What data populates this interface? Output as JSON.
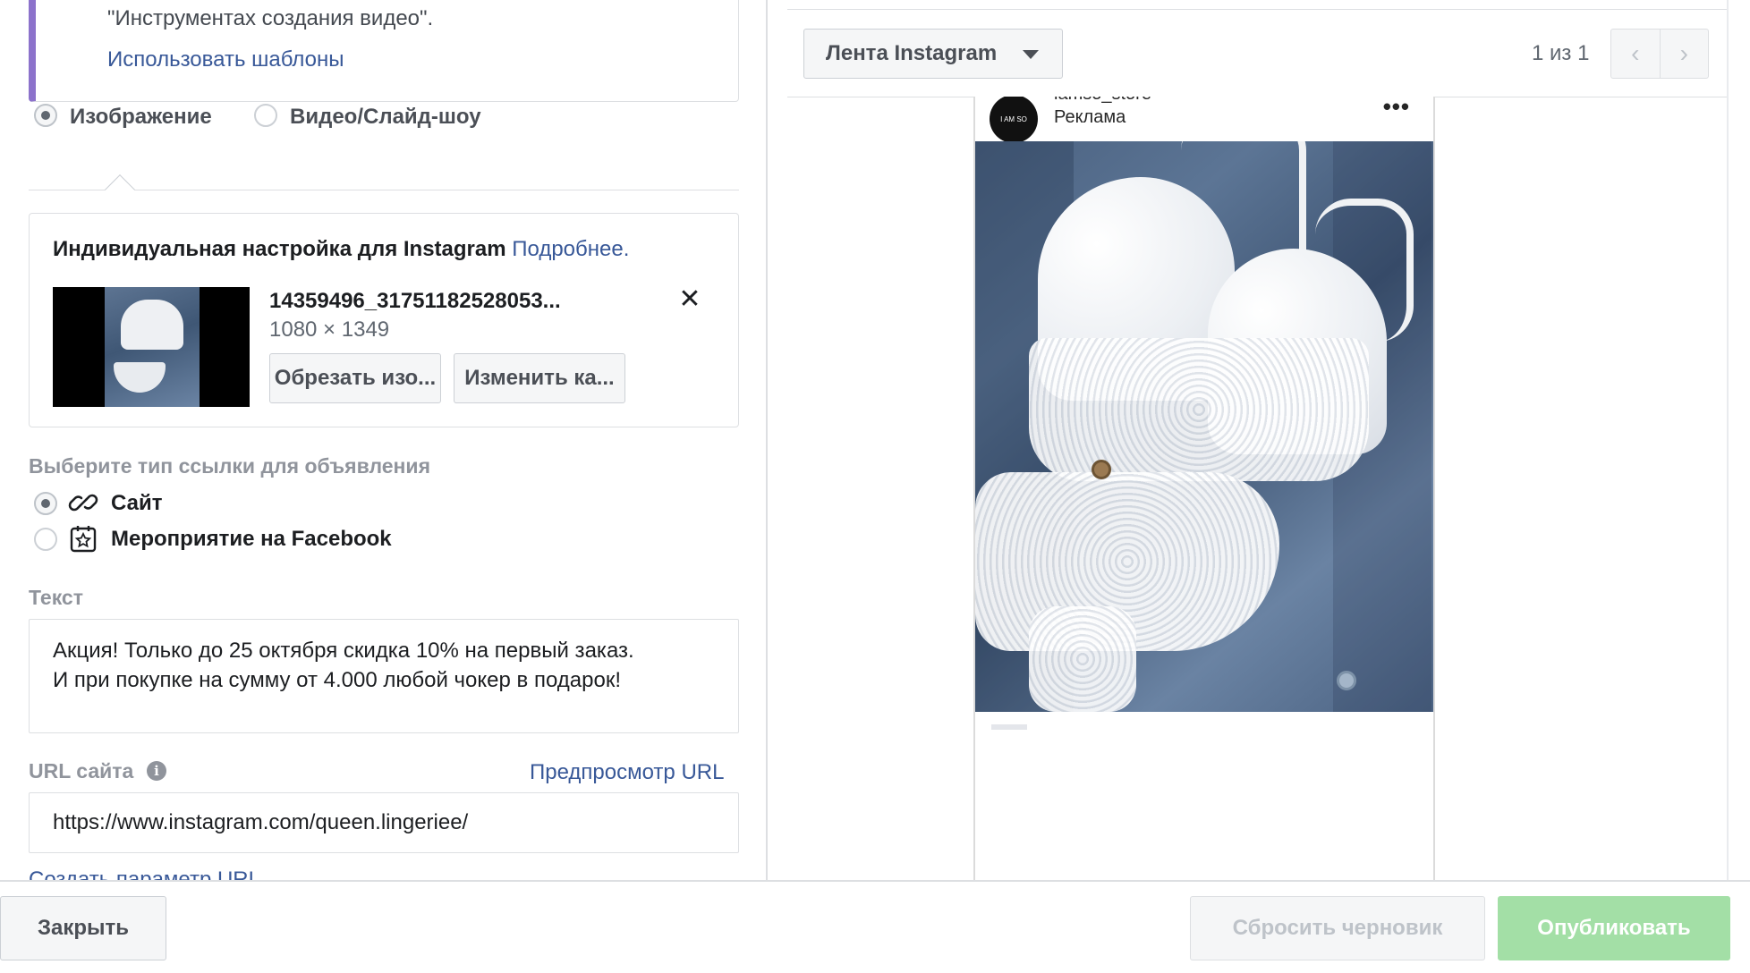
{
  "template_block": {
    "description": "\"Инструментах создания видео\".",
    "link": "Использовать шаблоны"
  },
  "media_type": {
    "options": [
      {
        "label": "Изображение",
        "selected": true
      },
      {
        "label": "Видео/Слайд-шоу",
        "selected": false
      }
    ]
  },
  "instagram_custom": {
    "title": "Индивидуальная настройка для Instagram",
    "more_link": "Подробнее.",
    "file_name": "14359496_31751182528053...",
    "file_size": "1080 × 1349",
    "crop_button": "Обрезать изо...",
    "change_button": "Изменить ка..."
  },
  "link_type": {
    "label": "Выберите тип ссылки для объявления",
    "options": [
      {
        "label": "Сайт",
        "selected": true,
        "icon": "link-icon"
      },
      {
        "label": "Мероприятие на Facebook",
        "selected": false,
        "icon": "event-star-icon"
      }
    ]
  },
  "text_field": {
    "label": "Текст",
    "lines": [
      "Акция! Только до 25 октября скидка 10% на первый заказ.",
      "И при покупке на сумму от 4.000 любой чокер в подарок!"
    ]
  },
  "url_field": {
    "label": "URL сайта",
    "preview_link": "Предпросмотр URL",
    "value": "https://www.instagram.com/queen.lingeriee/",
    "param_link": "Создать параметр URL"
  },
  "preview": {
    "placement": "Лента Instagram",
    "pager": "1 из 1",
    "prev_icon": "‹",
    "next_icon": "›",
    "account": "iamso_store",
    "sponsored": "Реклама",
    "avatar_text": "I AM SO",
    "menu_icon": "•••"
  },
  "footer": {
    "close": "Закрыть",
    "reset": "Сбросить черновик",
    "publish": "Опубликовать"
  },
  "colors": {
    "accent_purple": "#8c72cb",
    "link_blue": "#385898",
    "publish_green": "#a3dfa6"
  }
}
